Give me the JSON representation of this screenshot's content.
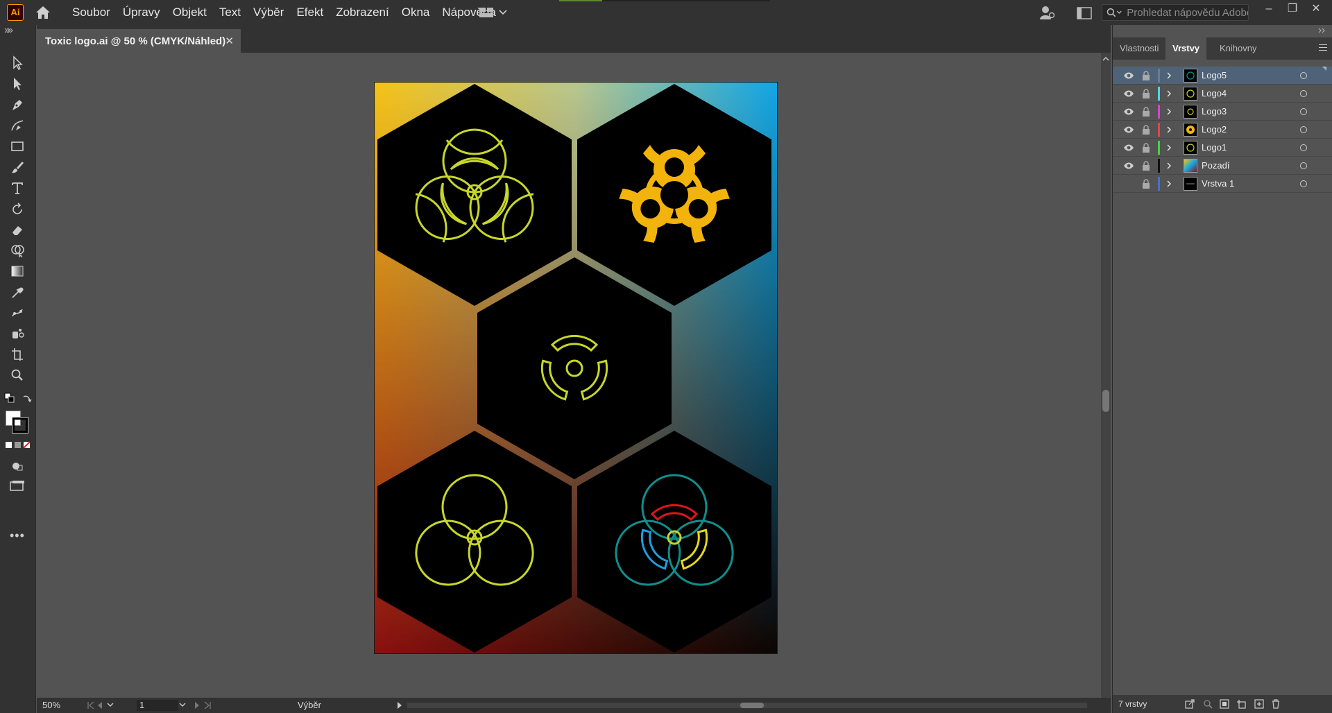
{
  "app": {
    "logo": "Ai",
    "menu": [
      "Soubor",
      "Úpravy",
      "Objekt",
      "Text",
      "Výběr",
      "Efekt",
      "Zobrazení",
      "Okna",
      "Nápověda"
    ],
    "search_placeholder": "Prohledat nápovědu Adobe",
    "window_controls": [
      "–",
      "❐",
      "✕"
    ]
  },
  "toolbar": {
    "tools": [
      "selection-tool",
      "direct-selection-tool",
      "pen-tool",
      "curvature-tool",
      "rectangle-tool",
      "paintbrush-tool",
      "type-tool",
      "rotate-tool",
      "eraser-tool",
      "shape-builder-tool",
      "gradient-tool",
      "eyedropper-tool",
      "puppet-warp-tool",
      "symbol-sprayer-tool",
      "artboard-tool",
      "zoom-tool"
    ],
    "more": "•••"
  },
  "document": {
    "tab_title": "Toxic logo.ai @ 50 % (CMYK/Náhled)",
    "close": "✕",
    "zoom": "50%",
    "page": "1",
    "mode": "Výběr",
    "artwork": {
      "background_gradient": [
        "#f5c418",
        "#12a6e6",
        "#8b1010",
        "#1a0a05"
      ],
      "hexagon_color": "#000000",
      "logo_colors": [
        "#c8d62a",
        "#f2b30c",
        "#c8d62a",
        "#c8d62a",
        "#0f8f8c"
      ],
      "accent_colors": [
        "#e0141a",
        "#1f9ee0",
        "#e6d81a"
      ]
    }
  },
  "panel": {
    "tabs": [
      "Vlastnosti",
      "Vrstvy",
      "Knihovny"
    ],
    "active_tab": "Vrstvy",
    "layers": [
      {
        "name": "Logo5",
        "color": "#6b7d8f",
        "visible": true,
        "selected": true
      },
      {
        "name": "Logo4",
        "color": "#4fd6e0",
        "visible": true,
        "selected": false
      },
      {
        "name": "Logo3",
        "color": "#d246d2",
        "visible": true,
        "selected": false
      },
      {
        "name": "Logo2",
        "color": "#e04848",
        "visible": true,
        "selected": false
      },
      {
        "name": "Logo1",
        "color": "#44d444",
        "visible": true,
        "selected": false
      },
      {
        "name": "Pozadí",
        "color": "#111111",
        "visible": true,
        "selected": false
      },
      {
        "name": "Vrstva 1",
        "color": "#4a6ed8",
        "visible": false,
        "selected": false
      }
    ],
    "layer_count": "7 vrstvy"
  }
}
